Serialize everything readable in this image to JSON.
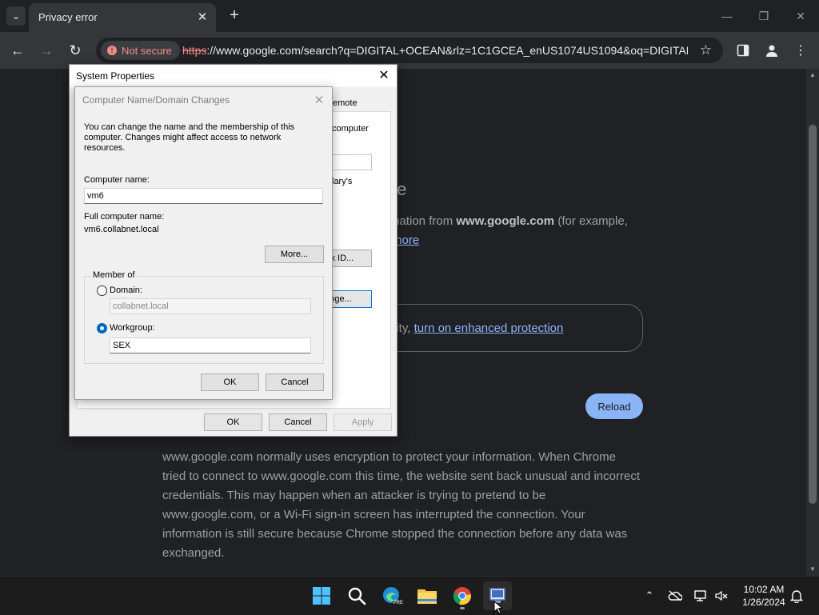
{
  "browser": {
    "tab_title": "Privacy error",
    "security_chip": "Not secure",
    "url_scheme": "https",
    "url_rest": "://www.google.com/search?q=DIGITAL+OCEAN&rlz=1C1GCEA_enUS1074US1094&oq=DIGITAL..."
  },
  "page": {
    "heading_fragment": "te",
    "line1_prefix": "mation from ",
    "line1_domain": "www.google.com",
    "line1_suffix": " (for example,",
    "learn_more_fragment": "more",
    "protection_prefix": "urity, ",
    "protection_link": "turn on enhanced protection",
    "reload_button": "Reload",
    "details_text": "www.google.com normally uses encryption to protect your information. When Chrome tried to connect to www.google.com this time, the website sent back unusual and incorrect credentials. This may happen when an attacker is trying to pretend to be www.google.com, or a Wi-Fi sign-in screen has interrupted the connection. Your information is still secure because Chrome stopped the connection before any data was exchanged."
  },
  "system_properties": {
    "title": "System Properties",
    "tab_fragment": "emote",
    "desc_fragment": "computer",
    "desc_fragment2": "lary's",
    "network_id_fragment": "rk ID...",
    "change_fragment": "nge...",
    "ok_button": "OK",
    "cancel_button": "Cancel",
    "apply_button": "Apply"
  },
  "computer_name_dialog": {
    "title": "Computer Name/Domain Changes",
    "description": "You can change the name and the membership of this computer. Changes might affect access to network resources.",
    "computer_name_label": "Computer name:",
    "computer_name_value": "vm6",
    "full_name_label": "Full computer name:",
    "full_name_value": "vm6.collabnet.local",
    "more_button": "More...",
    "member_of_label": "Member of",
    "domain_label": "Domain:",
    "domain_value": "collabnet.local",
    "workgroup_label": "Workgroup:",
    "workgroup_value": "SEX",
    "ok_button": "OK",
    "cancel_button": "Cancel",
    "selected_membership": "Workgroup"
  },
  "taskbar": {
    "time": "10:02 AM",
    "date": "1/26/2024",
    "edge_badge": "PRE"
  },
  "colors": {
    "accent_blue": "#8ab4f8",
    "warning_red": "#f28b82",
    "page_bg": "#202124"
  }
}
